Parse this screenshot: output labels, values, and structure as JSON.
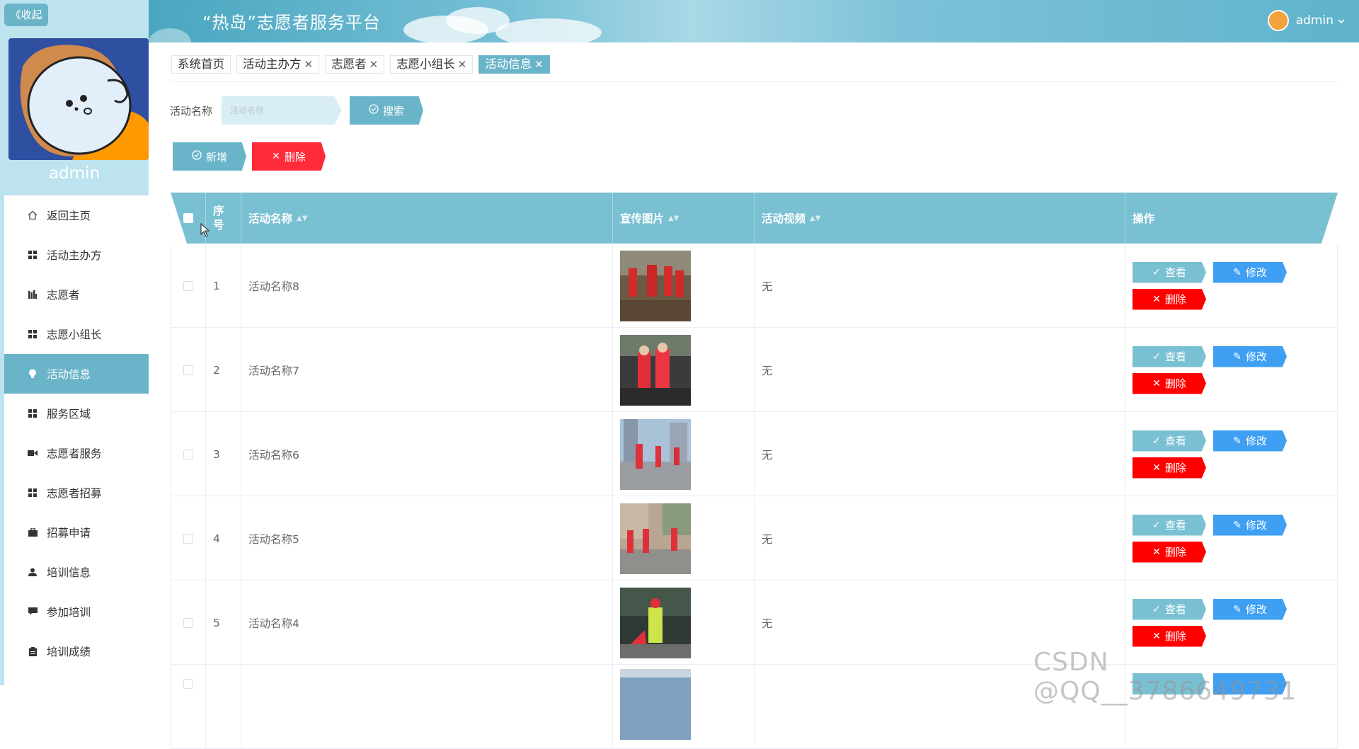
{
  "sidebar": {
    "collapse_label": "《收起",
    "username": "admin",
    "items": [
      {
        "label": "返回主页",
        "icon": "home-icon",
        "active": false
      },
      {
        "label": "活动主办方",
        "icon": "grid-icon",
        "active": false
      },
      {
        "label": "志愿者",
        "icon": "bar-chart-icon",
        "active": false
      },
      {
        "label": "志愿小组长",
        "icon": "grid-icon",
        "active": false
      },
      {
        "label": "活动信息",
        "icon": "bulb-icon",
        "active": true
      },
      {
        "label": "服务区域",
        "icon": "grid-icon",
        "active": false
      },
      {
        "label": "志愿者服务",
        "icon": "video-icon",
        "active": false
      },
      {
        "label": "志愿者招募",
        "icon": "grid-icon",
        "active": false
      },
      {
        "label": "招募申请",
        "icon": "briefcase-icon",
        "active": false
      },
      {
        "label": "培训信息",
        "icon": "user-icon",
        "active": false
      },
      {
        "label": "参加培训",
        "icon": "comment-icon",
        "active": false
      },
      {
        "label": "培训成绩",
        "icon": "clipboard-icon",
        "active": false
      }
    ]
  },
  "header": {
    "title": "“热岛”志愿者服务平台",
    "user": "admin",
    "dropdown_icon": "chevron-down-icon"
  },
  "tabs": [
    {
      "label": "系统首页",
      "closable": false,
      "active": false
    },
    {
      "label": "活动主办方",
      "closable": true,
      "active": false
    },
    {
      "label": "志愿者",
      "closable": true,
      "active": false
    },
    {
      "label": "志愿小组长",
      "closable": true,
      "active": false
    },
    {
      "label": "活动信息",
      "closable": true,
      "active": true
    }
  ],
  "search": {
    "label": "活动名称",
    "placeholder": "活动名称",
    "button": "搜索"
  },
  "actions": {
    "add": "新增",
    "delete": "删除"
  },
  "table": {
    "columns": {
      "index": "序号",
      "name": "活动名称",
      "image": "宣传图片",
      "video": "活动视频",
      "ops": "操作"
    },
    "rows": [
      {
        "index": "1",
        "name": "活动名称8",
        "video": "无"
      },
      {
        "index": "2",
        "name": "活动名称7",
        "video": "无"
      },
      {
        "index": "3",
        "name": "活动名称6",
        "video": "无"
      },
      {
        "index": "4",
        "name": "活动名称5",
        "video": "无"
      },
      {
        "index": "5",
        "name": "活动名称4",
        "video": "无"
      },
      {
        "index": "",
        "name": "",
        "video": ""
      }
    ],
    "row_buttons": {
      "view": "查看",
      "edit": "修改",
      "delete": "删除"
    }
  },
  "watermark": "CSDN @QQ__3786649731",
  "colors": {
    "accent": "#6ab4c9",
    "header_bg": "#7ac0d3",
    "danger": "#ff0000",
    "edit": "#3e9ff3"
  }
}
